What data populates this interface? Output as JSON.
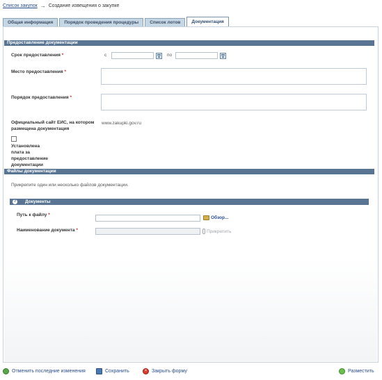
{
  "breadcrumb": {
    "link": "Список закупок",
    "arrow": "→",
    "current": "Создание извещения о закупке"
  },
  "tabs": [
    {
      "label": "Общая информация",
      "active": false
    },
    {
      "label": "Порядок проведения процедуры",
      "active": false
    },
    {
      "label": "Список лотов",
      "active": false
    },
    {
      "label": "Документация",
      "active": true
    }
  ],
  "section_provision": {
    "title": "Предоставление документации",
    "period_label": "Срок предоставления",
    "from_label": "с",
    "to_label": "по",
    "from_value": "",
    "to_value": "",
    "place_label": "Место предоставления",
    "place_value": "",
    "order_label": "Порядок предоставления",
    "order_value": "",
    "site_label": "Официальный сайт ЕИС, на котором размещена документация",
    "site_value": "www.zakupki.gov.ru",
    "fee_label": "Установлена плата за предоставление документации",
    "fee_checked": false,
    "required_mark": "*"
  },
  "section_files": {
    "title": "Файлы документации",
    "hint": "Прикрепите один или несколько файлов документации."
  },
  "documents": {
    "title": "Документы",
    "help_symbol": "?",
    "path_label": "Путь к файлу",
    "path_value": "",
    "browse_label": "Обзор...",
    "name_label": "Наименование документа",
    "name_value": "",
    "attach_label": "Прикрепить",
    "required_mark": "*"
  },
  "footer": {
    "undo_label": "Отменить последние изменения",
    "save_label": "Сохранить",
    "close_label": "Закрыть форму",
    "publish_label": "Разместить"
  },
  "colors": {
    "header_bar": "#5a7594",
    "link": "#2a4d8f",
    "required": "#d2282c",
    "tab_inactive": "#c5d6e5"
  },
  "icons": {
    "calendar": "calendar-icon",
    "folder": "folder-icon",
    "paperclip": "paperclip-icon",
    "undo": "undo-icon",
    "save": "save-icon",
    "close": "close-icon",
    "publish": "publish-icon",
    "help": "help-icon"
  }
}
